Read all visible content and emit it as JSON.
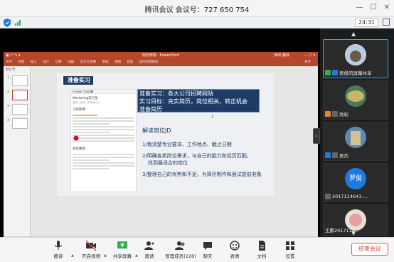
{
  "window": {
    "title": "腾讯会议  会议号：727 650 754"
  },
  "status": {
    "timer": "24:31"
  },
  "ppt": {
    "title_bar": "简历修改  ·  PowerPoint",
    "user": "西风 翻译",
    "menu": [
      "文件",
      "开始",
      "插入",
      "设计",
      "切换",
      "动画",
      "幻灯片放映",
      "审阅",
      "视图",
      "帮助",
      "操作说明搜索"
    ],
    "share_label": "共享",
    "thumb_header": "默认节",
    "slide": {
      "heading": "准备实习",
      "callout": [
        "准备实习：各大公司招聘网站",
        "实习目标：充实简历，岗位相关，转正机会",
        "准备简历"
      ],
      "section_title": "解读岗位JD",
      "steps": [
        "1/看清楚专业要求、工作地点、截止日期",
        "2/明确各类岗位需求，与自己的能力和经历匹配，",
        "找到最适合的岗位",
        "3/整理自己的优势和不足，为简历制作和面试提前准备"
      ],
      "jd": {
        "bar": "HUAWEI 华为招聘",
        "name": "Marketing实习生",
        "meta": "营销 | 深圳 | 本科及以上",
        "section1": "工作职责:",
        "section2": "岗位要求:"
      }
    },
    "status_left": "幻灯片 第 2 张，共 4 张",
    "zoom": "60%"
  },
  "participants": [
    {
      "name": "贾俊的屏幕共享"
    },
    {
      "name": "尚彩"
    },
    {
      "name": "吴杰"
    },
    {
      "name": "2017114641-...",
      "avatar_text": "罗俊"
    },
    {
      "name": "王鹏2017114..."
    }
  ],
  "toolbar": {
    "items": [
      "静音",
      "开启视频",
      "共享屏幕",
      "邀请",
      "管理成员(228)",
      "聊天",
      "表情",
      "文档",
      "设置"
    ],
    "end": "结束会议"
  },
  "colors": {
    "accent": "#1f7ae0",
    "end": "#e04040",
    "ppt": "#b7472a",
    "slide_navy": "#1f3c66"
  }
}
